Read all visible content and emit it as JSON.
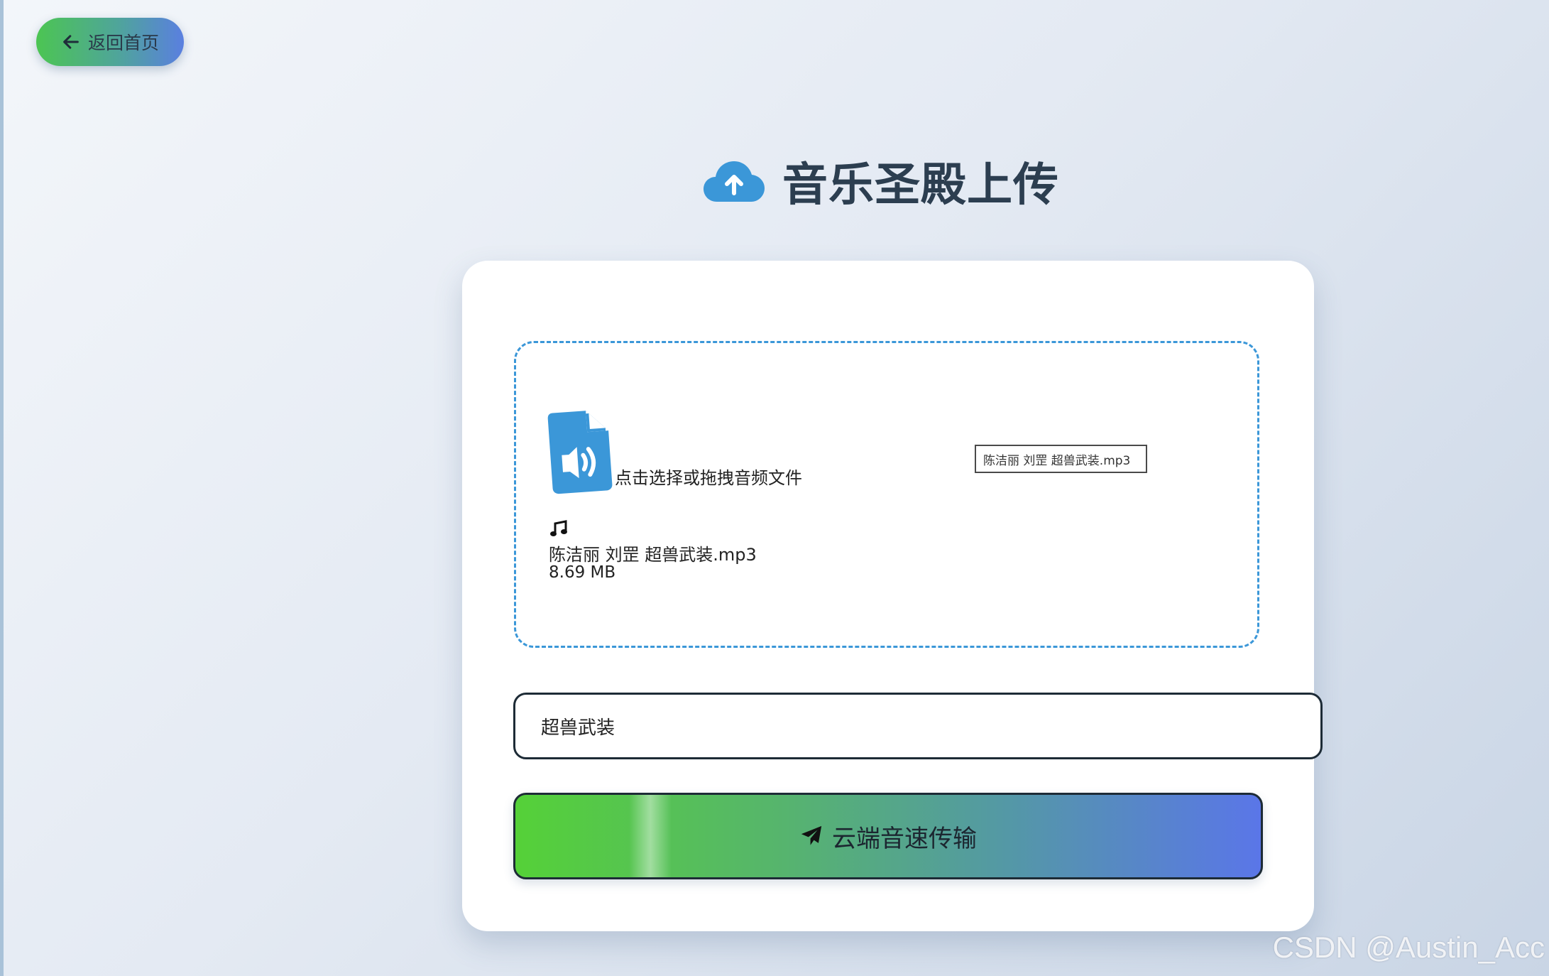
{
  "nav": {
    "back_label": "返回首页",
    "back_icon": "arrow-left-icon"
  },
  "header": {
    "title": "音乐圣殿上传",
    "icon": "cloud-upload-icon"
  },
  "upload": {
    "icon": "file-audio-icon",
    "hint": "点击选择或拖拽音频文件",
    "native_input_value": "陈洁丽 刘罡  超兽武装.mp3",
    "selected_file": {
      "icon": "music-note-icon",
      "name": "陈洁丽 刘罡 超兽武装.mp3",
      "size": "8.69 MB"
    }
  },
  "form": {
    "title_value": "超兽武装",
    "submit_label": "云端音速传输",
    "submit_icon": "paper-plane-icon"
  },
  "watermark": "CSDN @Austin_Acc",
  "colors": {
    "accent_blue": "#3b97d8",
    "gradient_start": "#55d138",
    "gradient_end": "#5a76e8",
    "title_color": "#2c3e50"
  }
}
